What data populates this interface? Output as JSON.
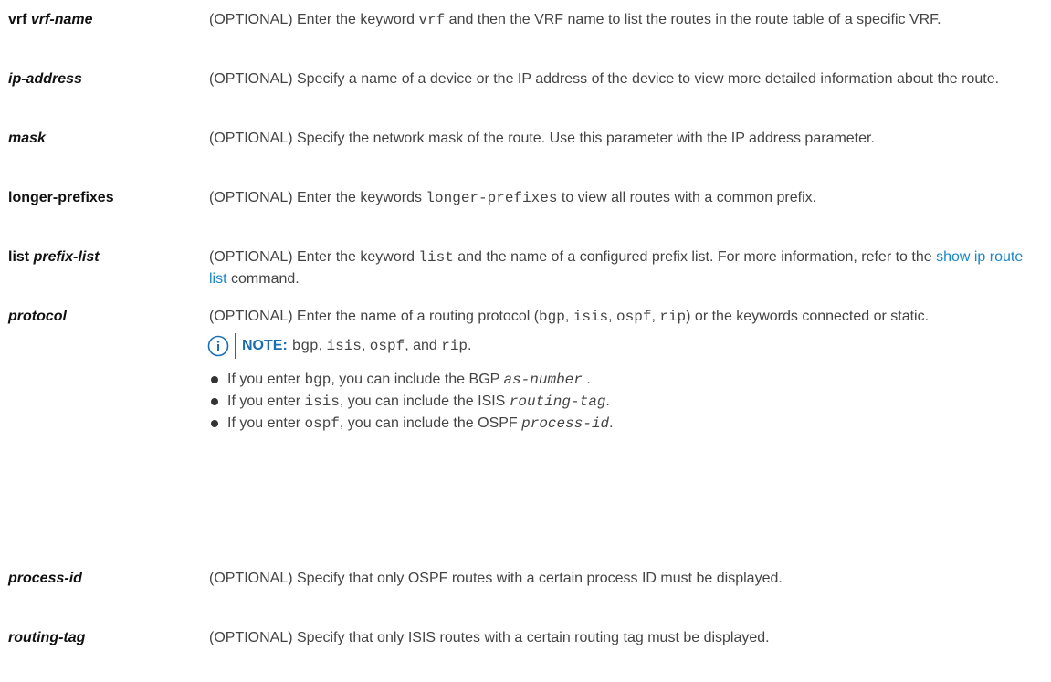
{
  "params": [
    {
      "term_keyword": "vrf",
      "term_param": "vrf-name",
      "desc_a": "(OPTIONAL) Enter the keyword ",
      "desc_code": "vrf",
      "desc_b": " and then the VRF name to list the routes in the route table of a specific VRF."
    },
    {
      "term_param": "ip-address",
      "desc": "(OPTIONAL) Specify a name of a device or the IP address of the device to view more detailed information about the route."
    },
    {
      "term_param": "mask",
      "desc": "(OPTIONAL) Specify the network mask of the route. Use this parameter with the IP address parameter."
    },
    {
      "term_keyword": "longer-prefixes",
      "desc_a": "(OPTIONAL) Enter the keywords ",
      "desc_code": "longer-prefixes",
      "desc_b": " to view all routes with a common prefix."
    },
    {
      "term_keyword": "list",
      "term_param": "prefix-list",
      "desc_a": "(OPTIONAL) Enter the keyword ",
      "desc_code": "list",
      "desc_b": " and the name of a configured prefix list. For more information, refer to the ",
      "desc_link": "show ip route list",
      "desc_c": " command."
    },
    {
      "term_param": "protocol",
      "desc_a": "(OPTIONAL) Enter the name of a routing protocol (",
      "code_bgp": "bgp",
      "sep1": ", ",
      "code_isis": "isis",
      "sep2": ", ",
      "code_ospf": "ospf",
      "sep3": ", ",
      "code_rip": "rip",
      "desc_b": ") or the keywords connected or static.",
      "note_label": "NOTE:",
      "note_code_bgp": "bgp",
      "note_sep1": ", ",
      "note_code_isis": "isis",
      "note_sep2": ", ",
      "note_code_ospf": "ospf",
      "note_sep3": ", and ",
      "note_code_rip": "rip",
      "note_end": ".",
      "bullets": [
        {
          "a": "If you enter ",
          "code": "bgp",
          "b": ", you can include the BGP ",
          "var": "as-number",
          "c": " ."
        },
        {
          "a": "If you enter ",
          "code": "isis",
          "b": ", you can include the ISIS ",
          "var": "routing-tag",
          "c": "."
        },
        {
          "a": "If you enter ",
          "code": "ospf",
          "b": ", you can include the OSPF ",
          "var": "process-id",
          "c": "."
        }
      ]
    },
    {
      "term_param": "process-id",
      "desc": "(OPTIONAL) Specify that only OSPF routes with a certain process ID must be displayed."
    },
    {
      "term_param": "routing-tag",
      "desc": "(OPTIONAL) Specify that only ISIS routes with a certain routing tag must be displayed."
    }
  ],
  "icons": {
    "note": "info-circle-icon"
  },
  "colors": {
    "link": "#1a86c8",
    "note": "#1a6fb3",
    "text": "#444444",
    "term": "#111111"
  }
}
